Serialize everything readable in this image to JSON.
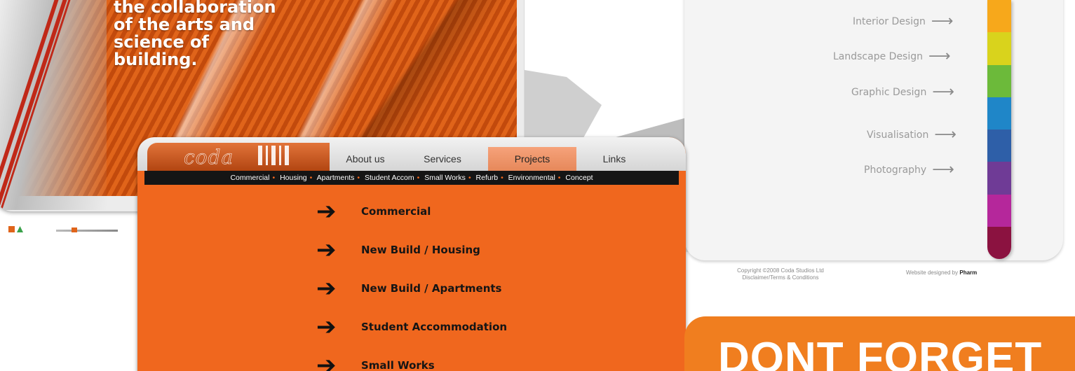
{
  "hero": {
    "tagline_lines": [
      "the collaboration",
      "of the arts and",
      "science of",
      "building."
    ]
  },
  "site": {
    "menu": [
      {
        "label": "Interior Design",
        "icon": "arrow-right-icon"
      },
      {
        "label": "Landscape Design",
        "icon": "arrow-right-icon"
      },
      {
        "label": "Graphic Design",
        "icon": "arrow-right-icon"
      },
      {
        "label": "Visualisation",
        "icon": "arrow-right-icon"
      },
      {
        "label": "Photography",
        "icon": "arrow-right-icon"
      }
    ],
    "color_bar": [
      "#f7a81b",
      "#d9d31c",
      "#6cba3a",
      "#1f86c8",
      "#2e5fa8",
      "#6f3b96",
      "#b5279b",
      "#8b1240"
    ],
    "footer": {
      "copyright": "Copyright ©2008 Coda Studios Ltd",
      "disclaimer": "Disclaimer/Terms & Conditions",
      "designed_prefix": "Website designed by",
      "designer": "Pharm"
    }
  },
  "coda": {
    "logo": "coda",
    "tabs": [
      "About us",
      "Services",
      "Projects",
      "Links"
    ],
    "active_tab": "Projects",
    "subnav": [
      "Commercial",
      "Housing",
      "Apartments",
      "Student Accom",
      "Small Works",
      "Refurb",
      "Environmental",
      "Concept"
    ],
    "list": [
      {
        "label": "Commercial",
        "icon": "arrow-right-icon"
      },
      {
        "label": "New Build / Housing",
        "icon": "arrow-right-icon"
      },
      {
        "label": "New Build / Apartments",
        "icon": "arrow-right-icon"
      },
      {
        "label": "Student Accommodation",
        "icon": "arrow-right-icon"
      },
      {
        "label": "Small Works",
        "icon": "arrow-right-icon"
      }
    ],
    "brand_color": "#f0671e"
  },
  "banner": {
    "text": "DONT FORGET"
  }
}
